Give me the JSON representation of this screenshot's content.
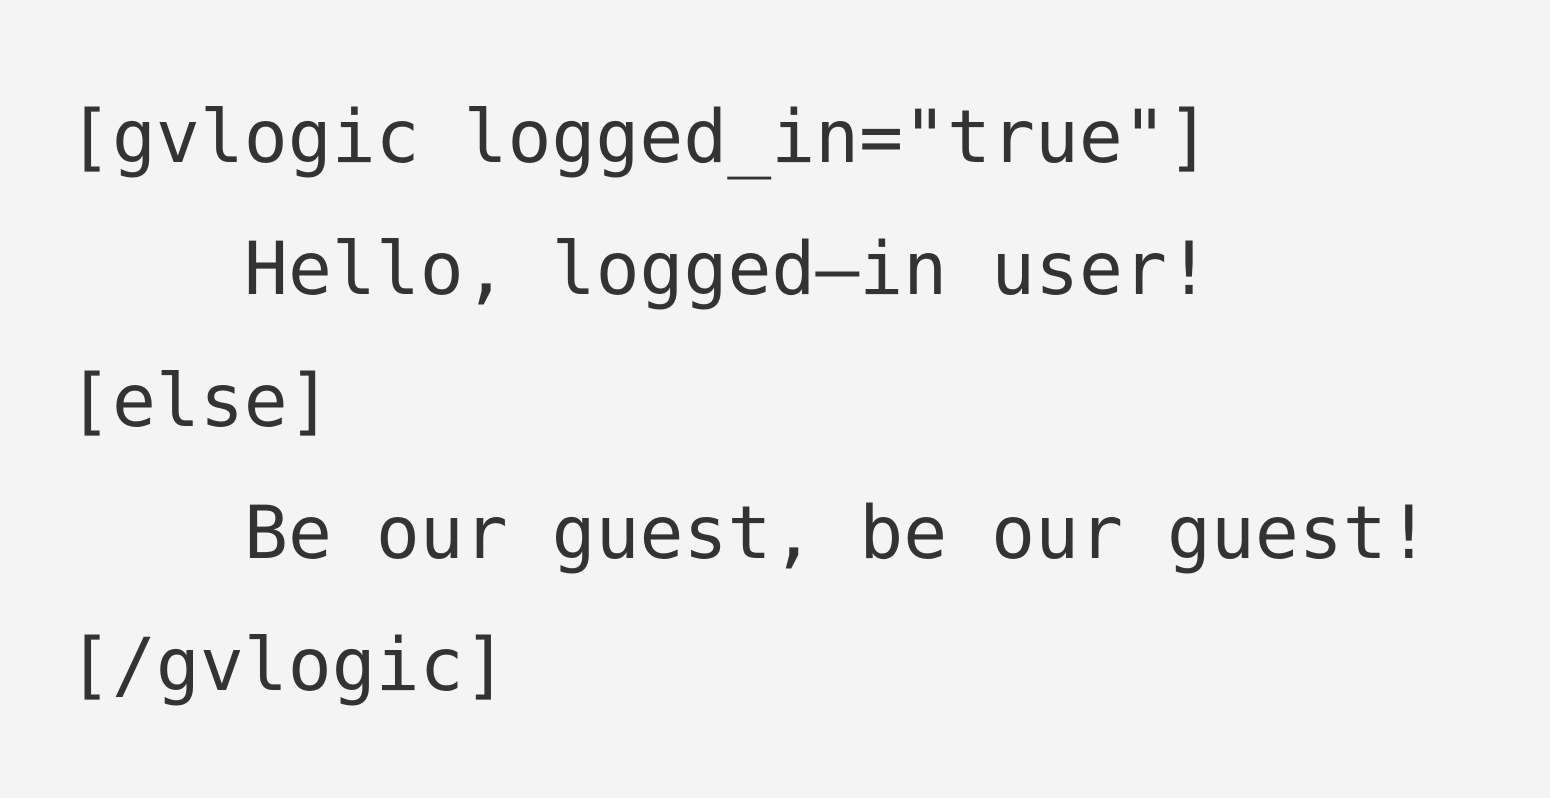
{
  "code_block": {
    "lines": [
      "[gvlogic logged_in=\"true\"]",
      "Hello, logged–in user!",
      "[else]",
      "Be our guest, be our guest!",
      "[/gvlogic]"
    ]
  },
  "colors": {
    "background": "#f4f4f4",
    "text": "#333333"
  }
}
